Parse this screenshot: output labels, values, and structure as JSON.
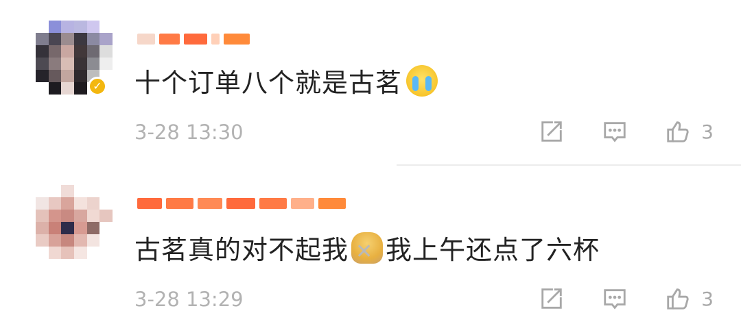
{
  "comments": [
    {
      "text": "十个订单八个就是古茗",
      "emoji": "loudly-crying-face",
      "time": "3-28 13:30",
      "likes": "3",
      "verified_badge": "✓"
    },
    {
      "text_before": "古茗真的对不起我",
      "emoji": "person-gesturing-no",
      "text_after": "我上午还点了六杯",
      "time": "3-28 13:29",
      "likes": "3"
    }
  ],
  "icons": {
    "share": "share-icon",
    "comment": "comment-icon",
    "like": "thumbs-up-icon"
  },
  "colors": {
    "text": "#222222",
    "meta": "#b2b2b2",
    "name_bar": "#ff6a3c",
    "badge": "#f3b70f",
    "icon": "#a8a8a8"
  }
}
